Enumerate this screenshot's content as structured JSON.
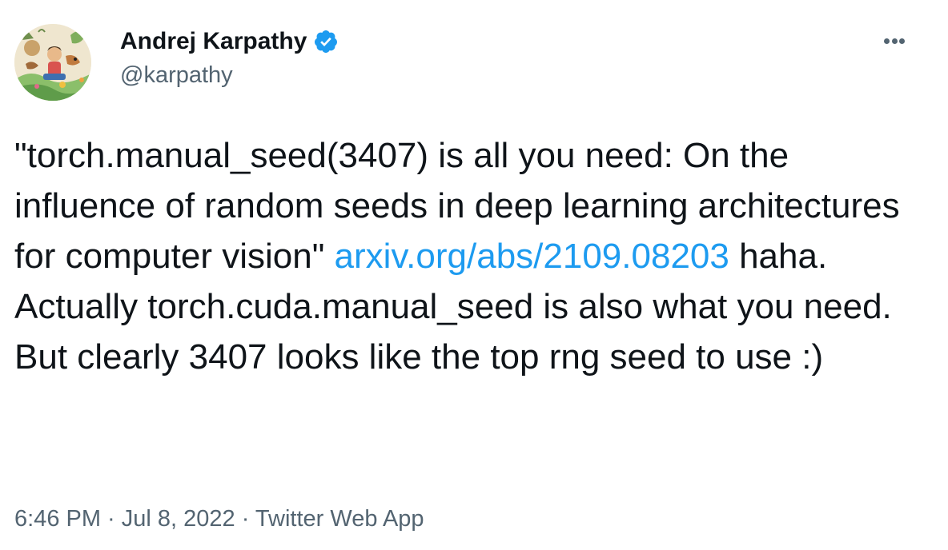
{
  "author": {
    "display_name": "Andrej Karpathy",
    "handle": "@karpathy",
    "verified": true,
    "avatar_icon": "illustrated-avatar",
    "verified_icon": "verified-badge-icon",
    "verified_color": "#1d9bf0"
  },
  "more_icon": "more-options-icon",
  "tweet": {
    "text_part1": "\"torch.manual_seed(3407) is all you need: On the influence of random seeds in deep learning architectures for computer vision\" ",
    "link_text": "arxiv.org/abs/2109.08203",
    "text_part2": " haha. Actually torch.cuda.manual_seed is also what you need. But clearly 3407 looks like the top rng seed to use :)",
    "link_color": "#1d9bf0"
  },
  "meta": {
    "time": "6:46 PM",
    "separator": " · ",
    "date": "Jul 8, 2022",
    "source": "Twitter Web App"
  }
}
